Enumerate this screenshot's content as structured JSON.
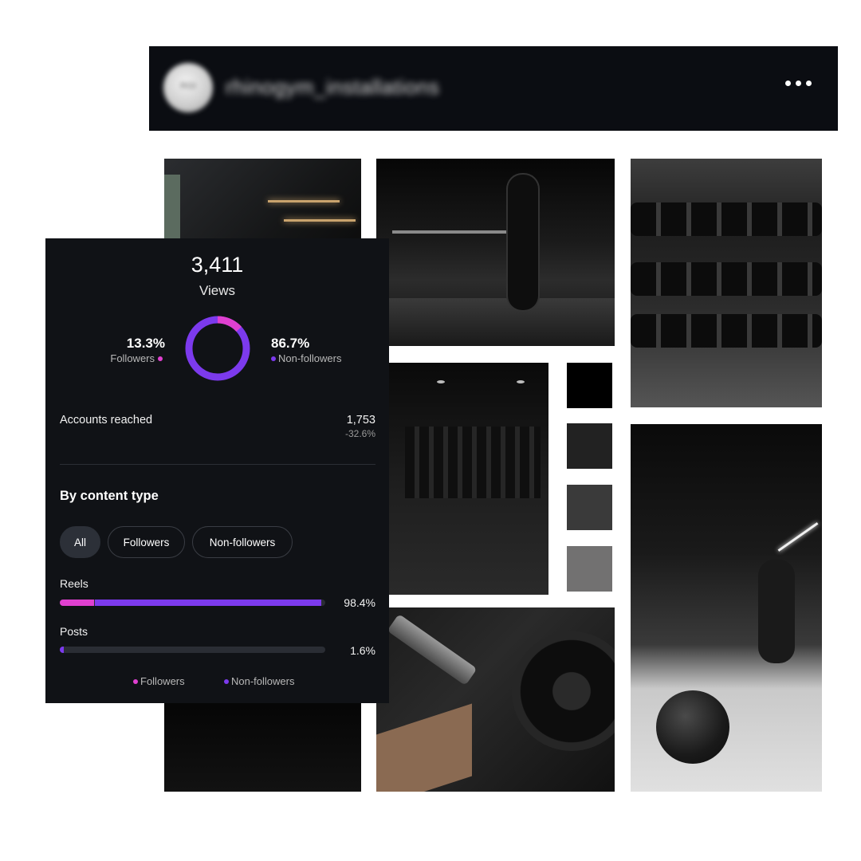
{
  "profile": {
    "avatar_text": "RGI",
    "username": "rhinogym_installations"
  },
  "palette": {
    "swatches": [
      "#000000",
      "#222222",
      "#3a3a3a",
      "#727171"
    ],
    "followers_color": "#e040d0",
    "non_followers_color": "#7c3aed"
  },
  "insights": {
    "views_value": "3,411",
    "views_label": "Views",
    "followers_pct": "13.3%",
    "followers_label": "Followers",
    "non_followers_pct": "86.7%",
    "non_followers_label": "Non-followers",
    "followers_fraction": 0.133,
    "accounts_reached_label": "Accounts reached",
    "accounts_reached_value": "1,753",
    "accounts_reached_change": "-32.6%",
    "content_type_title": "By content type",
    "filters": [
      "All",
      "Followers",
      "Non-followers"
    ],
    "selected_filter": "All",
    "content_rows": [
      {
        "label": "Reels",
        "pct_text": "98.4%",
        "total": 0.984,
        "followers": 0.13
      },
      {
        "label": "Posts",
        "pct_text": "1.6%",
        "total": 0.016,
        "followers": 0.0
      }
    ],
    "legend": [
      "Followers",
      "Non-followers"
    ]
  }
}
